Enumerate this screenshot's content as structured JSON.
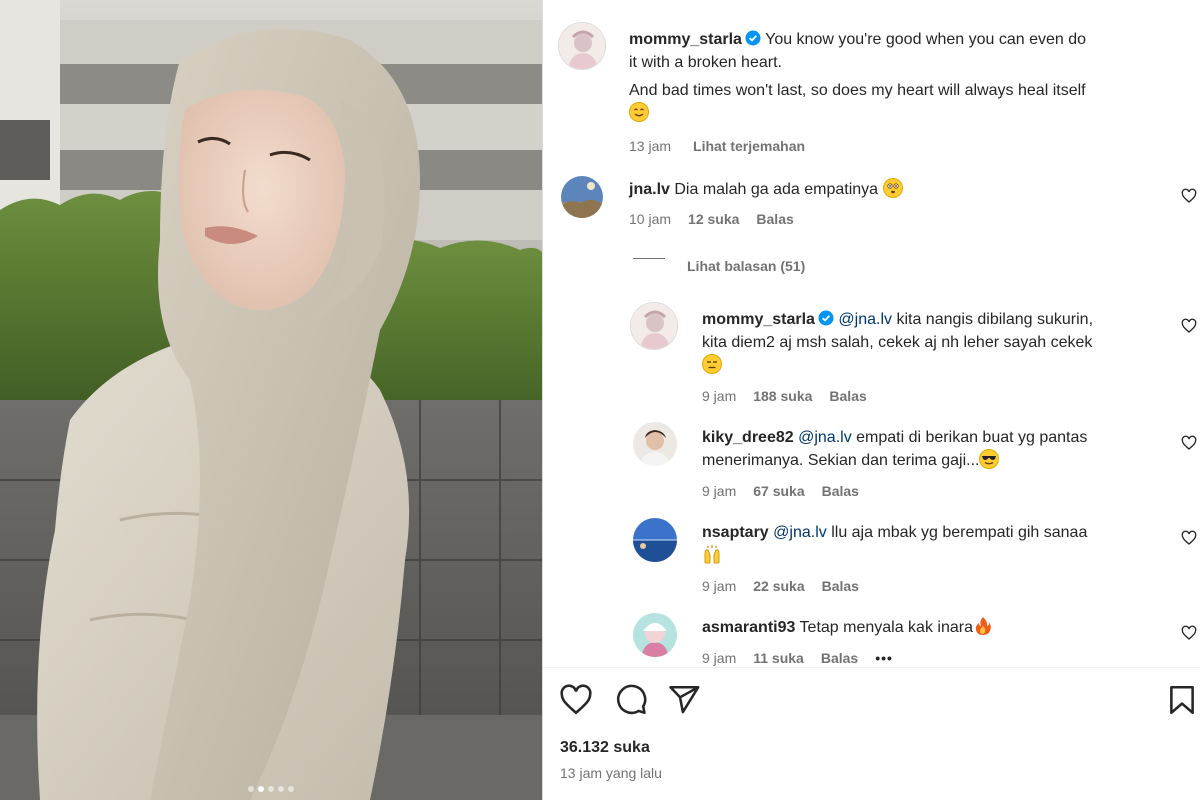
{
  "post": {
    "username": "mommy_starla",
    "caption_line1": "You know you're good when you can even do",
    "caption_line2": "it with a broken heart.",
    "caption_line3": "And bad times won't last, so does my heart will always heal itself",
    "time": "13 jam",
    "translate": "Lihat terjemahan"
  },
  "comments": [
    {
      "username": "jna.lv",
      "text": "Dia malah ga ada empatinya",
      "emoji": "flushed-face",
      "time": "10 jam",
      "likes": "12 suka",
      "reply": "Balas"
    }
  ],
  "view_replies": "Lihat balasan (51)",
  "replies": [
    {
      "username": "mommy_starla",
      "verified": true,
      "mention": "@jna.lv",
      "text_line1": "kita nangis dibilang sukurin,",
      "text_line2": "kita diem2 aj msh salah, cekek aj nh leher sayah cekek",
      "emoji": "expressionless-face",
      "time": "9 jam",
      "likes": "188 suka",
      "reply": "Balas"
    },
    {
      "username": "kiky_dree82",
      "mention": "@jna.lv",
      "text_line1": "empati di berikan buat yg pantas",
      "text_line2": "menerimanya. Sekian dan terima gaji...",
      "emoji": "sunglasses-face",
      "time": "9 jam",
      "likes": "67 suka",
      "reply": "Balas"
    },
    {
      "username": "nsaptary",
      "mention": "@jna.lv",
      "text_line1": "llu aja mbak yg berempati gih sanaa",
      "emoji": "raising-hands",
      "time": "9 jam",
      "likes": "22 suka",
      "reply": "Balas"
    },
    {
      "username": "asmaranti93",
      "text_line1": "Tetap menyala kak inara",
      "emoji": "fire",
      "time": "9 jam",
      "likes": "11 suka",
      "reply": "Balas",
      "more": "•••"
    }
  ],
  "footer": {
    "likes": "36.132 suka",
    "posted": "13 jam yang lalu"
  },
  "icons": [
    "heart-icon",
    "comment-icon",
    "share-icon",
    "bookmark-icon",
    "verified-icon",
    "more-icon"
  ],
  "colors": {
    "verified": "#0095f6",
    "mention": "#00376b",
    "muted": "#737373",
    "text": "#262626"
  },
  "carousel": {
    "total": 5,
    "active": 2
  }
}
